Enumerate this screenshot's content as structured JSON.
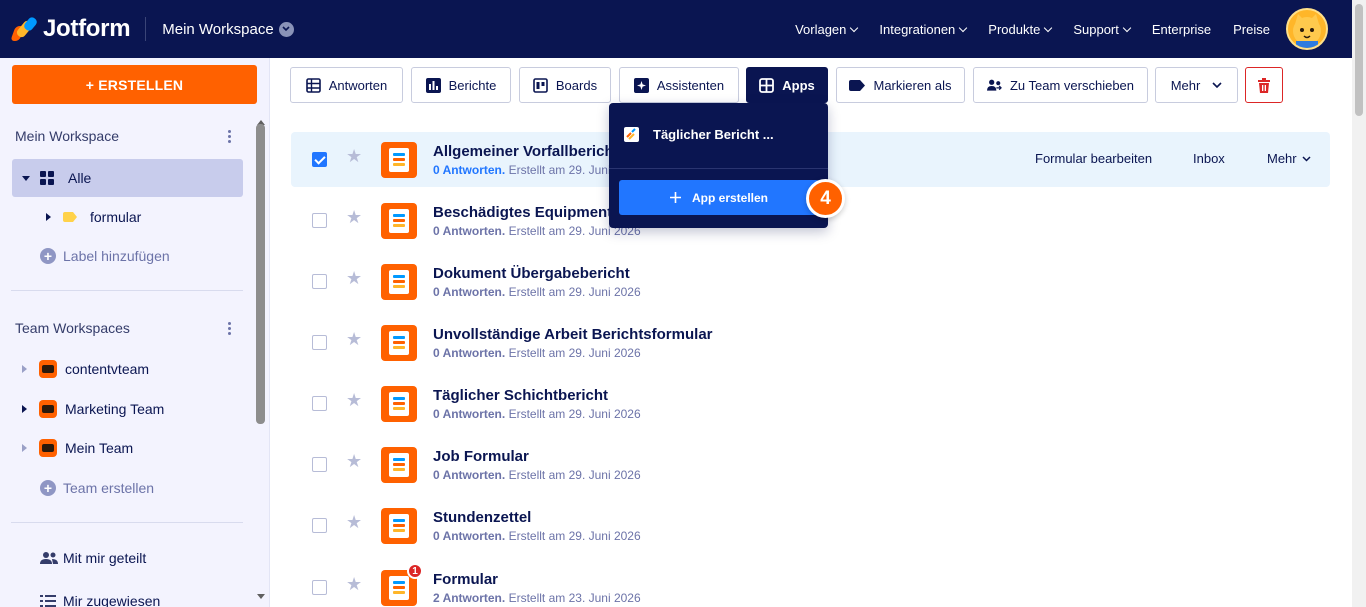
{
  "topbar": {
    "logo_text": "Jotform",
    "workspace_label": "Mein Workspace",
    "nav": [
      {
        "label": "Vorlagen",
        "has_menu": true
      },
      {
        "label": "Integrationen",
        "has_menu": true
      },
      {
        "label": "Produkte",
        "has_menu": true
      },
      {
        "label": "Support",
        "has_menu": true
      },
      {
        "label": "Enterprise",
        "has_menu": false
      },
      {
        "label": "Preise",
        "has_menu": false
      }
    ],
    "avatar_icon": "cat-avatar-icon"
  },
  "sidebar": {
    "create_label": "+ ERSTELLEN",
    "my_workspace_title": "Mein Workspace",
    "all_label": "Alle",
    "folder_label": "formular",
    "add_label": "Label hinzufügen",
    "team_workspaces_title": "Team Workspaces",
    "teams": [
      "contentvteam",
      "Marketing Team",
      "Mein Team"
    ],
    "create_team_label": "Team erstellen",
    "shared_label": "Mit mir geteilt",
    "assigned_label": "Mir zugewiesen"
  },
  "toolbar": {
    "antworten": "Antworten",
    "berichte": "Berichte",
    "boards": "Boards",
    "assistenten": "Assistenten",
    "apps": "Apps",
    "markieren": "Markieren als",
    "team": "Zu Team verschieben",
    "mehr": "Mehr"
  },
  "forms": [
    {
      "title": "Allgemeiner Vorfallbericht",
      "count": "0 Antworten.",
      "created": "Erstellt am 29. Juni 2026",
      "selected": true,
      "badge": ""
    },
    {
      "title": "Beschädigtes Equipment",
      "count": "0 Antworten.",
      "created": "Erstellt am 29. Juni 2026",
      "selected": false,
      "badge": ""
    },
    {
      "title": "Dokument Übergabebericht",
      "count": "0 Antworten.",
      "created": "Erstellt am 29. Juni 2026",
      "selected": false,
      "badge": ""
    },
    {
      "title": "Unvollständige Arbeit Berichtsformular",
      "count": "0 Antworten.",
      "created": "Erstellt am 29. Juni 2026",
      "selected": false,
      "badge": ""
    },
    {
      "title": "Täglicher Schichtbericht",
      "count": "0 Antworten.",
      "created": "Erstellt am 29. Juni 2026",
      "selected": false,
      "badge": ""
    },
    {
      "title": "Job Formular",
      "count": "0 Antworten.",
      "created": "Erstellt am 29. Juni 2026",
      "selected": false,
      "badge": ""
    },
    {
      "title": "Stundenzettel",
      "count": "0 Antworten.",
      "created": "Erstellt am 29. Juni 2026",
      "selected": false,
      "badge": ""
    },
    {
      "title": "Formular",
      "count": "2 Antworten.",
      "created": "Erstellt am 23. Juni 2026",
      "selected": false,
      "badge": "1"
    }
  ],
  "row_actions": {
    "edit": "Formular bearbeiten",
    "inbox": "Inbox",
    "more": "Mehr"
  },
  "apps_dropdown": {
    "item": "Täglicher Bericht ...",
    "create": "App erstellen"
  },
  "step_badge": "4",
  "colors": {
    "navy": "#0a1551",
    "orange": "#ff6100",
    "blue": "#2176ff",
    "red": "#dc2626"
  }
}
